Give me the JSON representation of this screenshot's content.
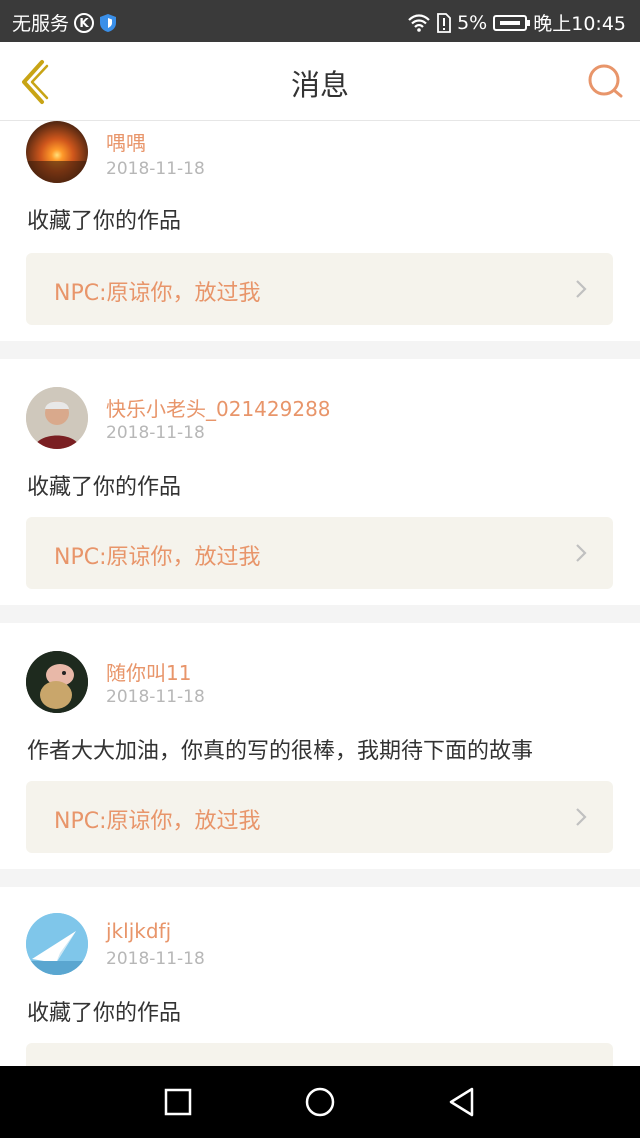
{
  "status_bar": {
    "carrier": "无服务",
    "k_badge": "K",
    "battery": "5%",
    "time": "晚上10:45"
  },
  "header": {
    "title": "消息",
    "back_icon": "chevron-left-icon",
    "search_icon": "search-icon"
  },
  "colors": {
    "accent": "#e8956a",
    "back": "#c8a415",
    "card_bg": "#f5f3ec"
  },
  "messages": [
    {
      "user": "喁喁",
      "date": "2018-11-18",
      "text": "收藏了你的作品",
      "work": "NPC:原谅你，放过我"
    },
    {
      "user": "快乐小老头_021429288",
      "date": "2018-11-18",
      "text": "收藏了你的作品",
      "work": "NPC:原谅你，放过我"
    },
    {
      "user": "随你叫11",
      "date": "2018-11-18",
      "text": "作者大大加油，你真的写的很棒，我期待下面的故事",
      "work": "NPC:原谅你，放过我"
    },
    {
      "user": "jkljkdfj",
      "date": "2018-11-18",
      "text": "收藏了你的作品",
      "work": ""
    }
  ],
  "nav": {
    "recent_icon": "square-icon",
    "home_icon": "circle-icon",
    "back_icon": "triangle-back-icon"
  }
}
